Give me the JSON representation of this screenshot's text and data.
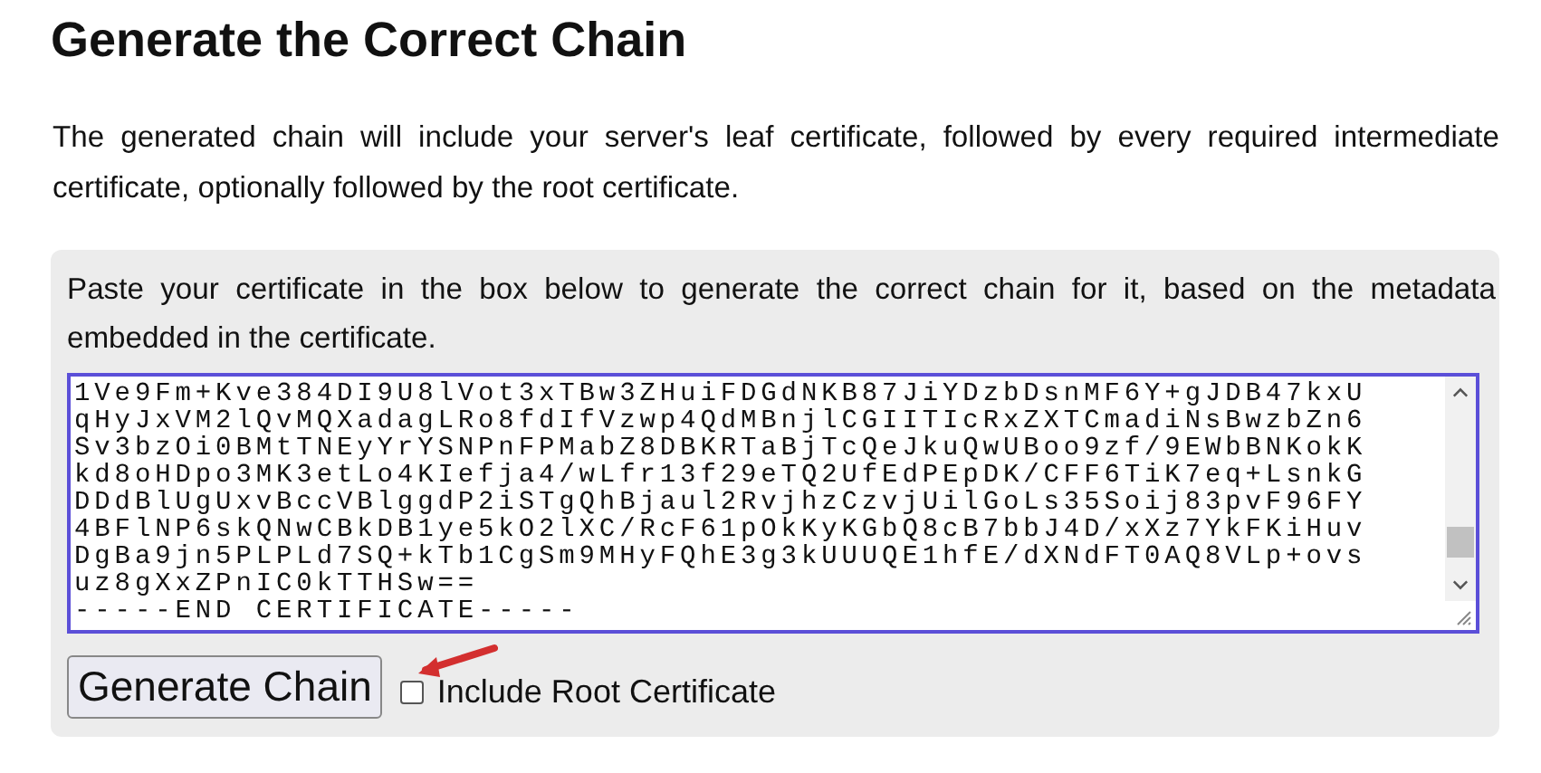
{
  "heading": "Generate the Correct Chain",
  "intro": "The generated chain will include your server's leaf certificate, followed by every required intermediate certificate, optionally followed by the root certificate.",
  "panel": {
    "instructions": "Paste your certificate in the box below to generate the correct chain for it, based on the metadata embedded in the certificate.",
    "certificate_lines": [
      "1Ve9Fm+Kve384DI9U8lVot3xTBw3ZHuiFDGdNKB87JiYDzbDsnMF6Y+gJDB47kxU",
      "qHyJxVM2lQvMQXadagLRo8fdIfVzwp4QdMBnjlCGIITIcRxZXTCmadiNsBwzbZn6",
      "Sv3bzOi0BMtTNEyYrYSNPnFPMabZ8DBKRTaBjTcQeJkuQwUBoo9zf/9EWbBNKokK",
      "kd8oHDpo3MK3etLo4KIefja4/wLfr13f29eTQ2UfEdPEpDK/CFF6TiK7eq+LsnkG",
      "DDdBlUgUxvBccVBlggdP2iSTgQhBjaul2RvjhzCzvjUilGoLs35Soij83pvF96FY",
      "4BFlNP6skQNwCBkDB1ye5kO2lXC/RcF61pOkKyKGbQ8cB7bbJ4D/xXz7YkFKiHuv",
      "DgBa9jn5PLPLd7SQ+kTb1CgSm9MHyFQhE3g3kUUUQE1hfE/dXNdFT0AQ8VLp+ovs",
      "uz8gXxZPnIC0kTTHSw==",
      "-----END CERTIFICATE-----"
    ],
    "button": "Generate Chain",
    "include_root": {
      "label": "Include Root Certificate",
      "checked": false
    }
  }
}
